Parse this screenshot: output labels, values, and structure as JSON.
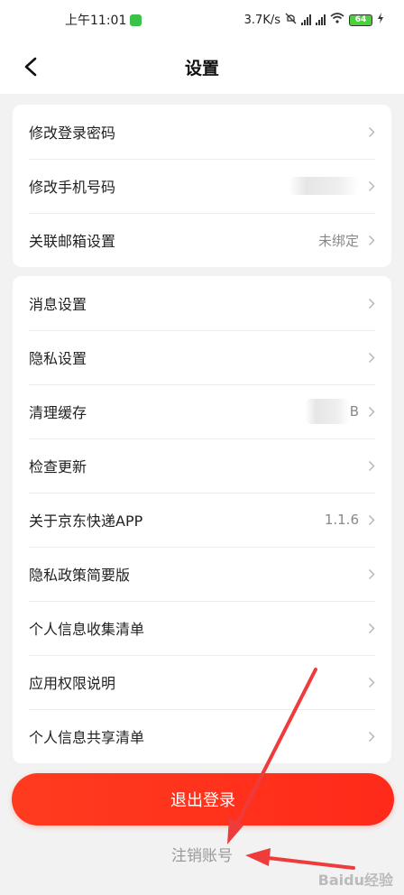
{
  "status": {
    "time": "上午11:01",
    "speed": "3.7K/s",
    "battery": "64"
  },
  "nav": {
    "title": "设置"
  },
  "group1": [
    {
      "label": "修改登录密码",
      "value": ""
    },
    {
      "label": "修改手机号码",
      "value": ""
    },
    {
      "label": "关联邮箱设置",
      "value": "未绑定"
    }
  ],
  "group2": [
    {
      "label": "消息设置",
      "value": ""
    },
    {
      "label": "隐私设置",
      "value": ""
    },
    {
      "label": "清理缓存",
      "value": "B"
    },
    {
      "label": "检查更新",
      "value": ""
    },
    {
      "label": "关于京东快递APP",
      "value": "1.1.6"
    },
    {
      "label": "隐私政策简要版",
      "value": ""
    },
    {
      "label": "个人信息收集清单",
      "value": ""
    },
    {
      "label": "应用权限说明",
      "value": ""
    },
    {
      "label": "个人信息共享清单",
      "value": ""
    }
  ],
  "actions": {
    "logout_label": "退出登录",
    "cancel_account_label": "注销账号"
  },
  "watermark": "Baidu经验",
  "colors": {
    "accent": "#ff2a1a",
    "background": "#f2f2f2",
    "annotation_arrow": "#ee3b3b"
  }
}
